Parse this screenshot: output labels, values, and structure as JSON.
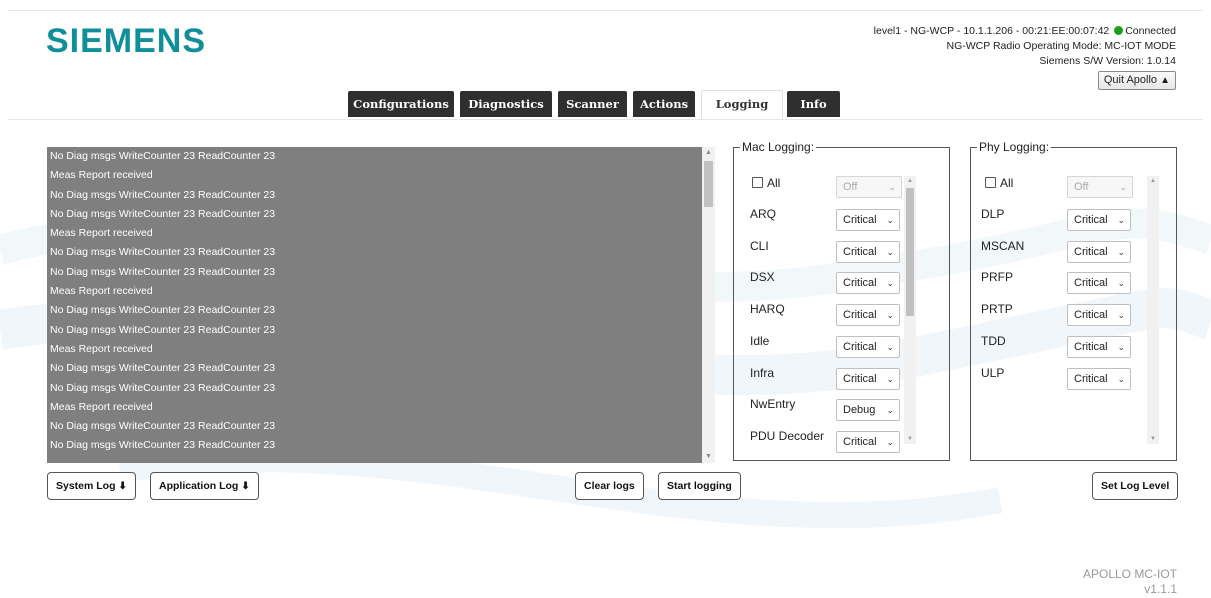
{
  "header": {
    "logo": "SIEMENS",
    "connection_line": "level1 - NG-WCP - 10.1.1.206 - 00:21:EE:00:07:42",
    "connection_status": "Connected",
    "mode_line": "NG-WCP Radio Operating Mode: MC-IOT MODE",
    "version_line": "Siemens S/W Version: 1.0.14",
    "quit_label": "Quit Apollo"
  },
  "tabs": [
    {
      "label": "Configurations"
    },
    {
      "label": "Diagnostics"
    },
    {
      "label": "Scanner"
    },
    {
      "label": "Actions"
    },
    {
      "label": "Logging"
    },
    {
      "label": "Info"
    }
  ],
  "active_tab": "Logging",
  "log": {
    "lines": [
      "No Diag msgs WriteCounter 23 ReadCounter 23",
      "Meas Report received",
      "No Diag msgs WriteCounter 23 ReadCounter 23",
      "No Diag msgs WriteCounter 23 ReadCounter 23",
      "Meas Report received",
      "No Diag msgs WriteCounter 23 ReadCounter 23",
      "No Diag msgs WriteCounter 23 ReadCounter 23",
      "Meas Report received",
      "No Diag msgs WriteCounter 23 ReadCounter 23",
      "No Diag msgs WriteCounter 23 ReadCounter 23",
      "Meas Report received",
      "No Diag msgs WriteCounter 23 ReadCounter 23",
      "No Diag msgs WriteCounter 23 ReadCounter 23",
      "Meas Report received",
      "No Diag msgs WriteCounter 23 ReadCounter 23",
      "No Diag msgs WriteCounter 23 ReadCounter 23"
    ]
  },
  "buttons": {
    "system_log": "System Log",
    "application_log": "Application Log",
    "clear_logs": "Clear logs",
    "start_logging": "Start logging",
    "set_log_level": "Set Log Level"
  },
  "mac_logging": {
    "legend": "Mac Logging:",
    "all_label": "All",
    "all_value": "Off",
    "items": [
      {
        "name": "ARQ",
        "level": "Critical"
      },
      {
        "name": "CLI",
        "level": "Critical"
      },
      {
        "name": "DSX",
        "level": "Critical"
      },
      {
        "name": "HARQ",
        "level": "Critical"
      },
      {
        "name": "Idle",
        "level": "Critical"
      },
      {
        "name": "Infra",
        "level": "Critical"
      },
      {
        "name": "NwEntry",
        "level": "Debug"
      },
      {
        "name": "PDU Decoder",
        "level": "Critical"
      }
    ]
  },
  "phy_logging": {
    "legend": "Phy Logging:",
    "all_label": "All",
    "all_value": "Off",
    "items": [
      {
        "name": "DLP",
        "level": "Critical"
      },
      {
        "name": "MSCAN",
        "level": "Critical"
      },
      {
        "name": "PRFP",
        "level": "Critical"
      },
      {
        "name": "PRTP",
        "level": "Critical"
      },
      {
        "name": "TDD",
        "level": "Critical"
      },
      {
        "name": "ULP",
        "level": "Critical"
      }
    ]
  },
  "footer": {
    "product": "APOLLO MC-IOT",
    "version": "v1.1.1"
  },
  "colors": {
    "brand": "#0f8f99",
    "tab_bg": "#2f2f2f",
    "log_bg": "#7f7f7f",
    "connected": "#1aa01a"
  },
  "icons": {
    "warning": "warning-icon",
    "download": "download-icon",
    "chevron": "chevron-down-icon"
  }
}
